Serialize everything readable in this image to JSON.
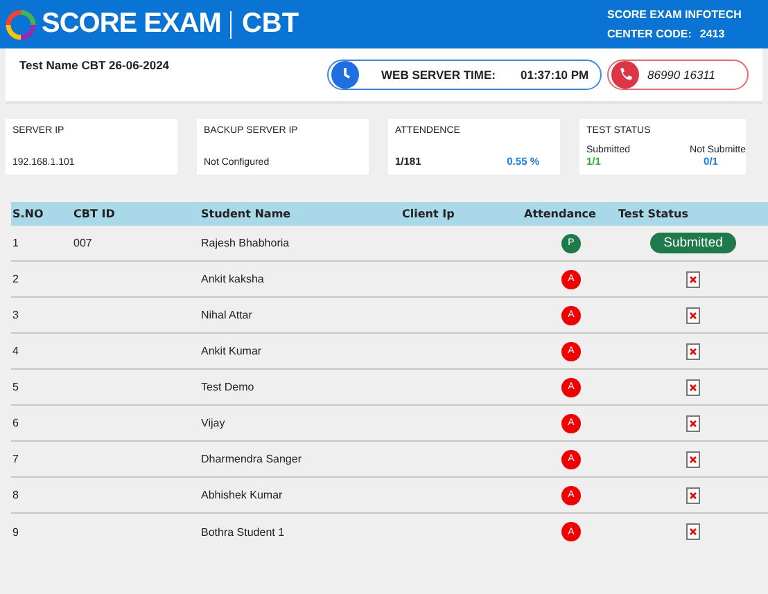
{
  "header": {
    "brand": "SCORE EXAM",
    "product": "CBT",
    "company": "SCORE EXAM INFOTECH",
    "center_code_label": "CENTER CODE:",
    "center_code": "2413"
  },
  "info_bar": {
    "test_name": "Test Name CBT 26-06-2024",
    "server_time_label": "WEB SERVER TIME:",
    "server_time": "01:37:10 PM",
    "phone": "86990 16311"
  },
  "cards": [
    {
      "kind": "plain",
      "title": "SERVER IP",
      "value": "192.168.1.101"
    },
    {
      "kind": "plain",
      "title": "BACKUP SERVER IP",
      "value": "Not Configured"
    },
    {
      "kind": "attendance",
      "title": "ATTENDENCE",
      "value": "1/181",
      "percent": "0.55 %"
    },
    {
      "kind": "status",
      "title": "TEST STATUS",
      "submitted_label": "Submitted",
      "submitted": "1/1",
      "not_submitted_label": "Not Submitte",
      "not_submitted": "0/1"
    }
  ],
  "table": {
    "columns": [
      "S.NO",
      "CBT ID",
      "Student Name",
      "Client Ip",
      "Attendance",
      "Test Status"
    ],
    "rows": [
      {
        "sno": "1",
        "cbt_id": "007",
        "name": "Rajesh Bhabhoria",
        "attendance": {
          "letter": "P",
          "present": true
        },
        "test_status": {
          "kind": "badge",
          "label": "Submitted"
        }
      },
      {
        "sno": "2",
        "name": "Ankit kaksha",
        "attendance": {
          "letter": "A",
          "present": false
        },
        "test_status": {
          "kind": "missing"
        }
      },
      {
        "sno": "3",
        "name": "Nihal Attar",
        "attendance": {
          "letter": "A",
          "present": false
        },
        "test_status": {
          "kind": "missing"
        }
      },
      {
        "sno": "4",
        "name": "Ankit Kumar",
        "attendance": {
          "letter": "A",
          "present": false
        },
        "test_status": {
          "kind": "missing"
        }
      },
      {
        "sno": "5",
        "name": "Test Demo",
        "attendance": {
          "letter": "A",
          "present": false
        },
        "test_status": {
          "kind": "missing"
        }
      },
      {
        "sno": "6",
        "name": "Vijay",
        "attendance": {
          "letter": "A",
          "present": false
        },
        "test_status": {
          "kind": "missing"
        }
      },
      {
        "sno": "7",
        "name": "Dharmendra Sanger",
        "attendance": {
          "letter": "A",
          "present": false
        },
        "test_status": {
          "kind": "missing"
        }
      },
      {
        "sno": "8",
        "name": "Abhishek Kumar",
        "attendance": {
          "letter": "A",
          "present": false
        },
        "test_status": {
          "kind": "missing"
        }
      },
      {
        "sno": "9",
        "name": "Bothra Student 1",
        "attendance": {
          "letter": "A",
          "present": false
        },
        "test_status": {
          "kind": "missing"
        }
      }
    ]
  }
}
